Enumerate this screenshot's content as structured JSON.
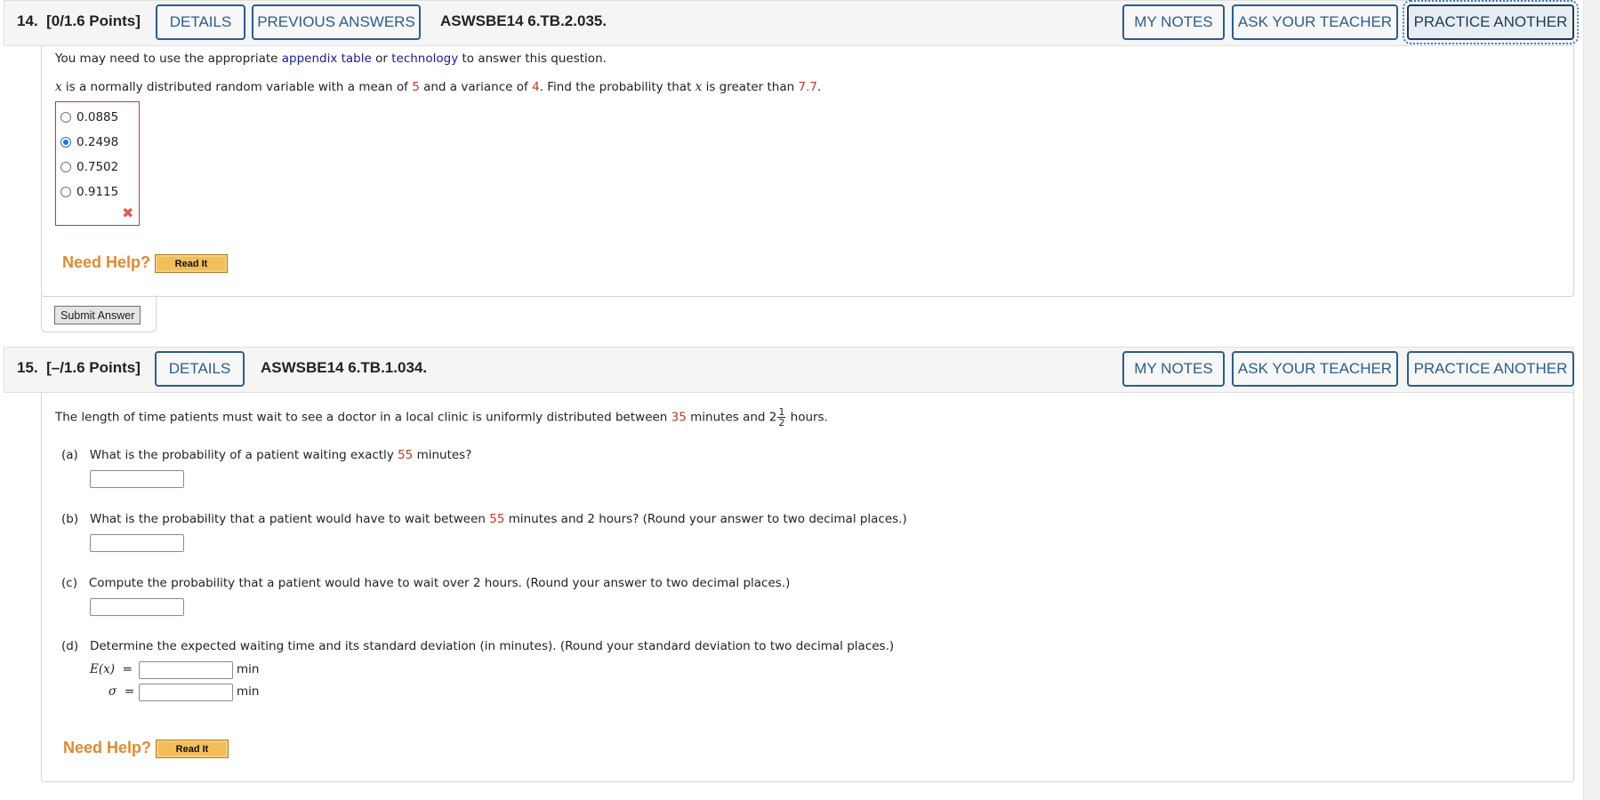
{
  "questions": [
    {
      "number_label": "14.",
      "points_label": "[0/1.6 Points]",
      "buttons_left": [
        "DETAILS",
        "PREVIOUS ANSWERS"
      ],
      "code": "ASWSBE14 6.TB.2.035.",
      "buttons_right": [
        "MY NOTES",
        "ASK YOUR TEACHER",
        "PRACTICE ANOTHER"
      ],
      "intro": {
        "pre": "You may need to use the appropriate ",
        "link1": "appendix table",
        "mid": " or ",
        "link2": "technology",
        "post": " to answer this question."
      },
      "prompt": {
        "var": "x",
        "p1": " is a normally distributed random variable with a mean of ",
        "mean": "5",
        "p2": " and a variance of ",
        "variance": "4",
        "p3": ". Find the probability that ",
        "var2": "x",
        "p4": " is greater than ",
        "threshold": "7.7",
        "p5": "."
      },
      "choices": [
        {
          "label": "0.0885",
          "selected": false
        },
        {
          "label": "0.2498",
          "selected": true
        },
        {
          "label": "0.7502",
          "selected": false
        },
        {
          "label": "0.9115",
          "selected": false
        }
      ],
      "result_icon": "incorrect-x-icon",
      "need_help": "Need Help?",
      "read_it": "Read It",
      "submit": "Submit Answer"
    },
    {
      "number_label": "15.",
      "points_label": "[–/1.6 Points]",
      "buttons_left": [
        "DETAILS"
      ],
      "code": "ASWSBE14 6.TB.1.034.",
      "buttons_right": [
        "MY NOTES",
        "ASK YOUR TEACHER",
        "PRACTICE ANOTHER"
      ],
      "stem": {
        "p1": "The length of time patients must wait to see a doctor in a local clinic is uniformly distributed between ",
        "low": "35",
        "p2": " minutes and ",
        "whole": "2",
        "frac_num": "1",
        "frac_den": "2",
        "p3": " hours."
      },
      "parts": {
        "a": {
          "label": "(a)",
          "pre": "What is the probability of a patient waiting exactly ",
          "val": "55",
          "post": " minutes?"
        },
        "b": {
          "label": "(b)",
          "pre": "What is the probability that a patient would have to wait between ",
          "val": "55",
          "post": " minutes and 2 hours? (Round your answer to two decimal places.)"
        },
        "c": {
          "label": "(c)",
          "text": "Compute the probability that a patient would have to wait over 2 hours. (Round your answer to two decimal places.)"
        },
        "d": {
          "label": "(d)",
          "text": "Determine the expected waiting time and its standard deviation (in minutes). (Round your standard deviation to two decimal places.)",
          "ex_label": "E(x)",
          "sigma_label": "σ",
          "eq": "=",
          "unit": "min"
        }
      },
      "need_help": "Need Help?",
      "read_it": "Read It"
    }
  ]
}
